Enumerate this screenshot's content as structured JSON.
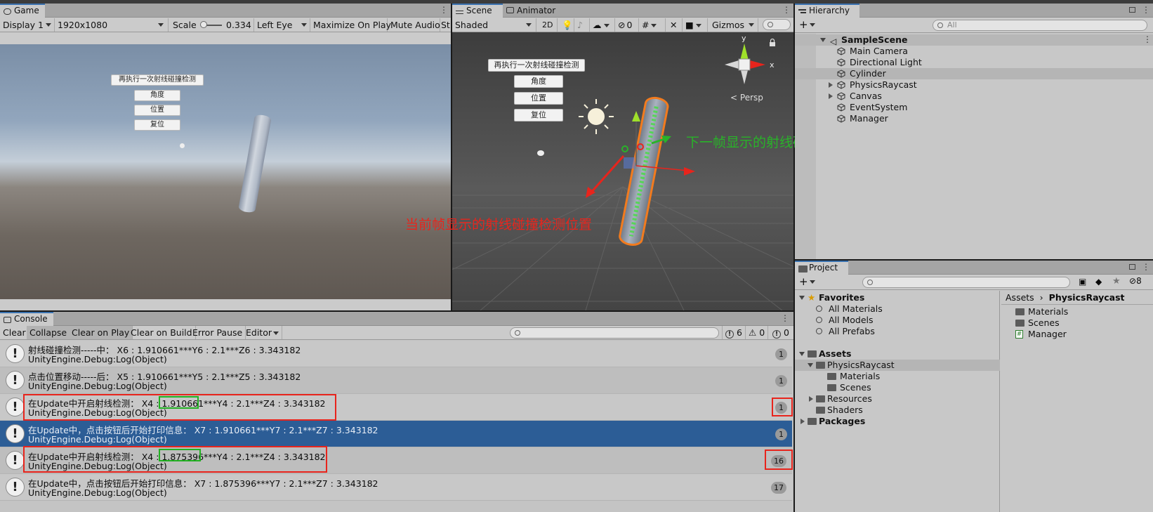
{
  "game": {
    "tab": "Game",
    "display": "Display 1",
    "resolution": "1920x1080",
    "scale_label": "Scale",
    "scale_value": "0.334",
    "eye": "Left Eye",
    "maximize": "Maximize On Play",
    "mute": "Mute Audio",
    "stats_cut": "St",
    "buttons": [
      "再执行一次射线碰撞检测",
      "角度",
      "位置",
      "复位"
    ]
  },
  "scene": {
    "tab_scene": "Scene",
    "tab_animator": "Animator",
    "shading": "Shaded",
    "mode_2d": "2D",
    "hidden_count": "0",
    "gizmos": "Gizmos",
    "persp": "Persp",
    "axis_x": "x",
    "axis_y": "y",
    "buttons": [
      "再执行一次射线碰撞检测",
      "角度",
      "位置",
      "复位"
    ],
    "annotation_next": "下一帧显示的射线碰撞检测位置",
    "annotation_current": "当前帧显示的射线碰撞检测位置",
    "colors": {
      "annotation_next": "#29b329",
      "annotation_current": "#e8241c",
      "selection": "#f27b1e"
    }
  },
  "hierarchy": {
    "tab": "Hierarchy",
    "search_placeholder": "All",
    "scene_name": "SampleScene",
    "items": [
      "Main Camera",
      "Directional Light",
      "Cylinder",
      "PhysicsRaycast",
      "Canvas",
      "EventSystem",
      "Manager"
    ],
    "selected": "Cylinder"
  },
  "project": {
    "tab": "Project",
    "hidden_packages": "8",
    "favorites": {
      "label": "Favorites",
      "items": [
        "All Materials",
        "All Models",
        "All Prefabs"
      ]
    },
    "assets": {
      "label": "Assets",
      "folder": "PhysicsRaycast",
      "sub": [
        "Materials",
        "Scenes"
      ],
      "others": [
        "Resources",
        "Shaders"
      ]
    },
    "packages": "Packages",
    "breadcrumb": [
      "Assets",
      "PhysicsRaycast"
    ],
    "contents": [
      "Materials",
      "Scenes",
      "Manager"
    ]
  },
  "console": {
    "tab": "Console",
    "toolbar": [
      "Clear",
      "Collapse",
      "Clear on Play",
      "Clear on Build",
      "Error Pause",
      "Editor"
    ],
    "counts": {
      "log": "6",
      "warn": "0",
      "error": "0"
    },
    "rows": [
      {
        "line1": "射线碰撞检测-----中：      X6 : 1.910661***Y6 : 2.1***Z6 : 3.343182",
        "line2": "UnityEngine.Debug:Log(Object)",
        "count": "1"
      },
      {
        "line1": "点击位置移动-----后：      X5 : 1.910661***Y5 : 2.1***Z5 : 3.343182",
        "line2": "UnityEngine.Debug:Log(Object)",
        "count": "1"
      },
      {
        "line1": "在Update中开启射线检测：      X4 : 1.910661***Y4 : 2.1***Z4 : 3.343182",
        "line2": "UnityEngine.Debug:Log(Object)",
        "count": "1"
      },
      {
        "line1": "在Update中，点击按钮后开始打印信息：      X7 : 1.910661***Y7 : 2.1***Z7 : 3.343182",
        "line2": "UnityEngine.Debug:Log(Object)",
        "count": "1"
      },
      {
        "line1": "在Update中开启射线检测：      X4 : 1.875396***Y4 : 2.1***Z4 : 3.343182",
        "line2": "UnityEngine.Debug:Log(Object)",
        "count": "16"
      },
      {
        "line1": "在Update中，点击按钮后开始打印信息：      X7 : 1.875396***Y7 : 2.1***Z7 : 3.343182",
        "line2": "UnityEngine.Debug:Log(Object)",
        "count": "17"
      }
    ],
    "selected_row": 3,
    "colors": {
      "selected": "#2c5d96",
      "highlight_box": "#e8241c",
      "value_box": "#22b022"
    }
  }
}
